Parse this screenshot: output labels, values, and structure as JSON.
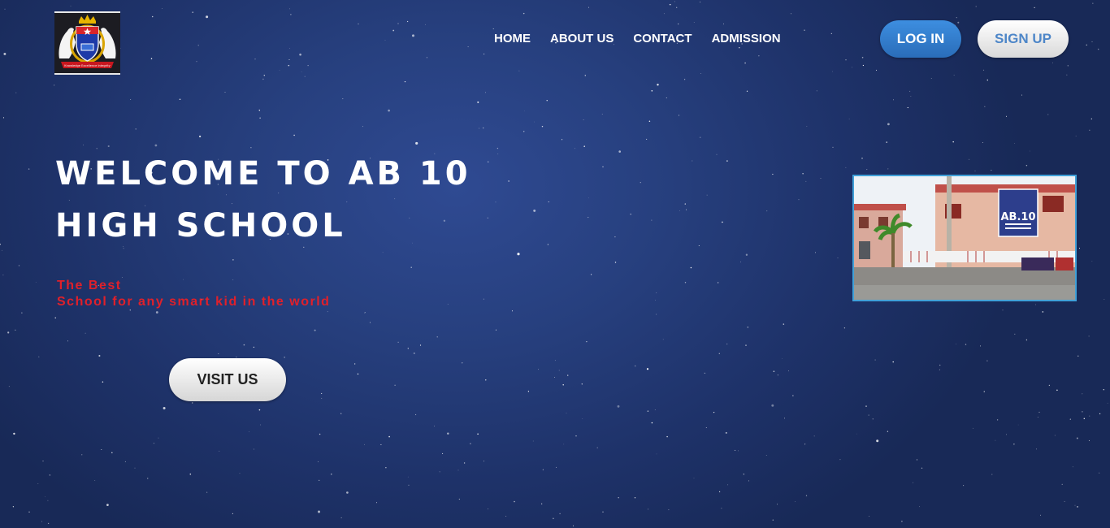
{
  "logo": {
    "icon": "school-crest-icon",
    "motto": "Knowledge Excellence Integrity"
  },
  "nav": {
    "items": [
      {
        "label": "HOME"
      },
      {
        "label": "ABOUT US"
      },
      {
        "label": "CONTACT"
      },
      {
        "label": "ADMISSION"
      }
    ]
  },
  "auth": {
    "login_label": "LOG IN",
    "signup_label": "SIGN UP"
  },
  "hero": {
    "title_line1": "WELCOME TO AB 10",
    "title_line2": "HIGH SCHOOL",
    "tagline_line1": "The Best",
    "tagline_line2": "School for any smart kid in the world",
    "cta_label": "VISIT US"
  },
  "photo": {
    "sign_text": "AB.10"
  },
  "colors": {
    "background": "#233a7a",
    "login_bg": "#3d8ee0",
    "signup_text": "#4d86c8",
    "tagline": "#e0202a",
    "photo_border": "#40a0d8"
  }
}
